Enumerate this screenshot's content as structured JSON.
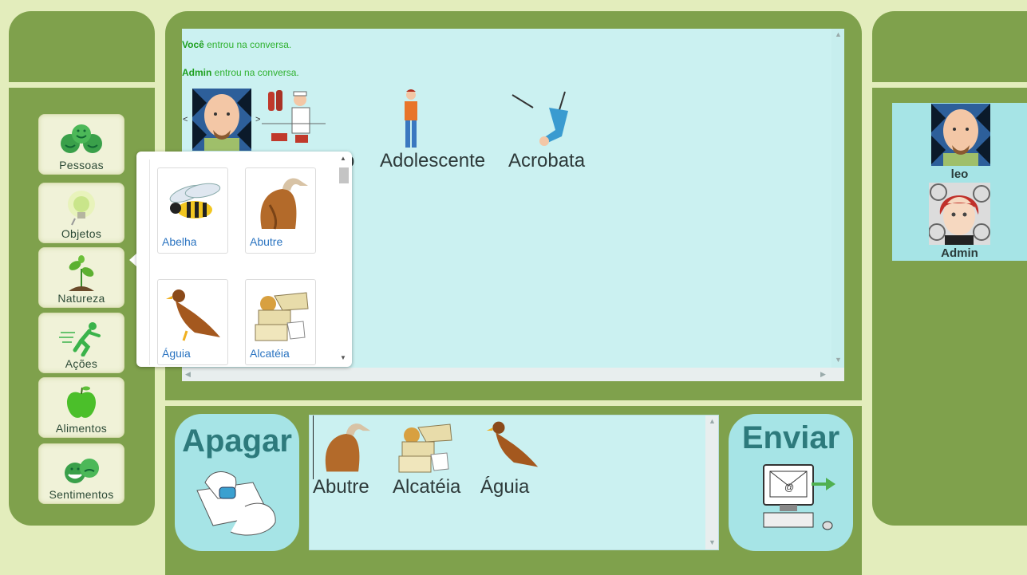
{
  "categories": [
    {
      "label": "Pessoas",
      "icon": "smiley-faces-icon"
    },
    {
      "label": "Objetos",
      "icon": "lightbulb-icon"
    },
    {
      "label": "Natureza",
      "icon": "sprout-icon"
    },
    {
      "label": "Ações",
      "icon": "running-figure-icon"
    },
    {
      "label": "Alimentos",
      "icon": "apple-icon"
    },
    {
      "label": "Sentimentos",
      "icon": "emotion-faces-icon"
    }
  ],
  "chat": {
    "messages": [
      {
        "user": "Você",
        "text": " entrou na conversa."
      },
      {
        "user": "Admin",
        "text": " entrou na conversa."
      }
    ],
    "carousel_prev": "<",
    "carousel_next": ">",
    "words": [
      "ro",
      "Adolescente",
      "Acrobata"
    ]
  },
  "popup": {
    "items": [
      {
        "label": "Abelha",
        "icon": "bee-icon"
      },
      {
        "label": "Abutre",
        "icon": "vulture-icon"
      },
      {
        "label": "Águia",
        "icon": "eagle-icon"
      },
      {
        "label": "Alcatéia",
        "icon": "wolf-pack-icon"
      }
    ]
  },
  "actions": {
    "clear_label": "Apagar",
    "send_label": "Enviar"
  },
  "compose": {
    "words": [
      "Abutre",
      "Alcatéia",
      "Águia"
    ]
  },
  "users": [
    {
      "name": "leo"
    },
    {
      "name": "Admin"
    }
  ],
  "colors": {
    "background": "#e3edbc",
    "panel": "#7fa14c",
    "chat_bg": "#cbf1f1",
    "button_bg": "#a6e4e6",
    "joined_text": "#2fb12f",
    "link_text": "#2b74c1"
  }
}
